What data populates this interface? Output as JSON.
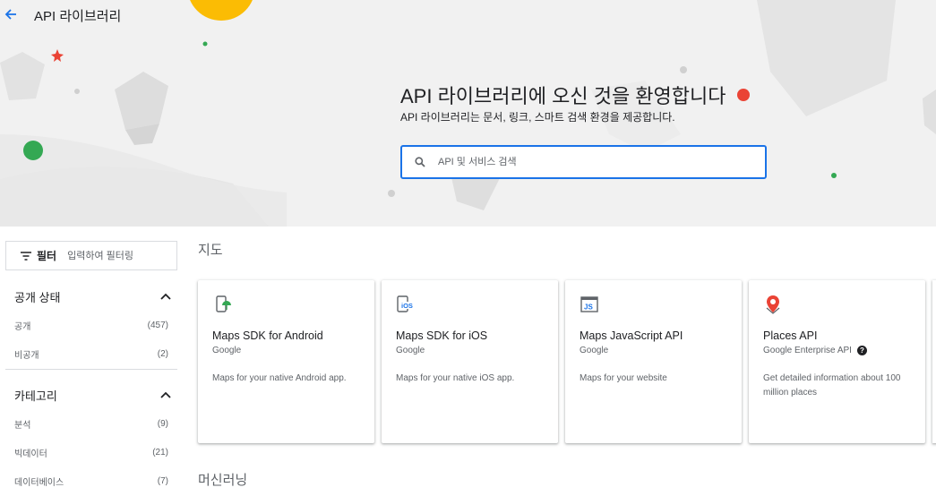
{
  "header": {
    "back_icon": "arrow-left-icon",
    "title": "API 라이브러리"
  },
  "hero": {
    "welcome_title": "API 라이브러리에 오신 것을 환영합니다",
    "welcome_subtitle": "API 라이브러리는 문서, 링크, 스마트 검색 환경을 제공합니다.",
    "search_placeholder": "API 및 서비스 검색",
    "search_value": ""
  },
  "sidebar": {
    "filter_label": "필터",
    "filter_placeholder": "입력하여 필터링",
    "facets": [
      {
        "title": "공개 상태",
        "items": [
          {
            "label": "공개",
            "count": "(457)"
          },
          {
            "label": "비공개",
            "count": "(2)"
          }
        ]
      },
      {
        "title": "카테고리",
        "items": [
          {
            "label": "분석",
            "count": "(9)"
          },
          {
            "label": "빅데이터",
            "count": "(21)"
          },
          {
            "label": "데이터베이스",
            "count": "(7)"
          }
        ]
      }
    ]
  },
  "main": {
    "sections": [
      {
        "title": "지도"
      },
      {
        "title": "머신러닝"
      }
    ],
    "cards": [
      {
        "title": "Maps SDK for Android",
        "provider": "Google",
        "description": "Maps for your native Android app.",
        "icon": "android-maps-icon"
      },
      {
        "title": "Maps SDK for iOS",
        "provider": "Google",
        "description": "Maps for your native iOS app.",
        "icon": "ios-maps-icon"
      },
      {
        "title": "Maps JavaScript API",
        "provider": "Google",
        "description": "Maps for your website",
        "icon": "javascript-maps-icon"
      },
      {
        "title": "Places API",
        "provider": "Google Enterprise API",
        "description": "Get detailed information about 100 million places",
        "icon": "places-pin-icon"
      }
    ]
  },
  "colors": {
    "accent": "#1a73e8",
    "red_dot": "#ea4335",
    "green_dot": "#34a853",
    "yellow_circle": "#fbbc04"
  }
}
